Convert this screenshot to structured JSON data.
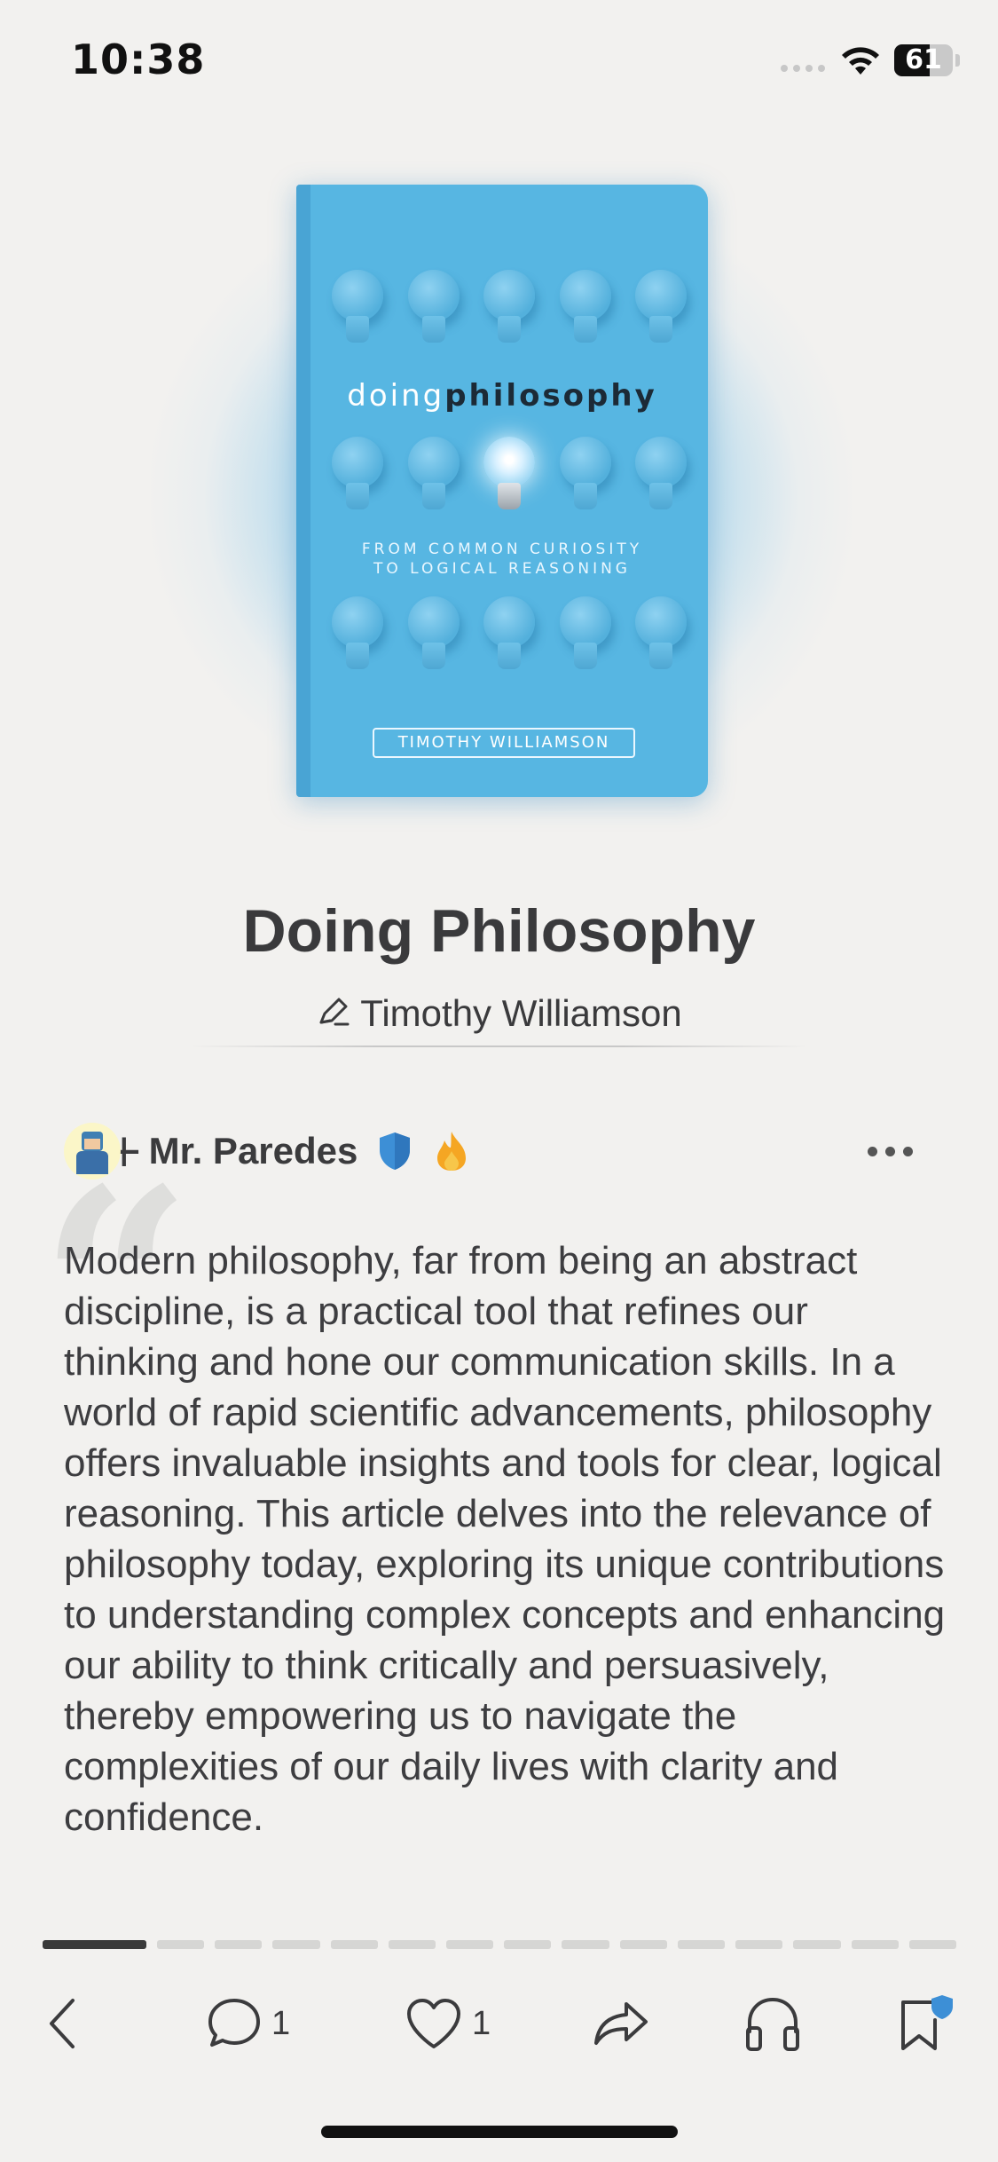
{
  "status_bar": {
    "time": "10:38",
    "battery": "61",
    "battery_level": 0.61
  },
  "cover": {
    "title_word1": "doing",
    "title_word2": "philosophy",
    "subtitle_line1": "FROM COMMON CURIOSITY",
    "subtitle_line2": "TO LOGICAL REASONING",
    "author": "TIMOTHY WILLIAMSON"
  },
  "book": {
    "title": "Doing Philosophy",
    "author": "Timothy Williamson"
  },
  "review": {
    "user_name": "Mr. Paredes",
    "text": "Modern philosophy, far from being an abstract discipline, is a practical tool that refines our thinking and hone our communication skills. In a world of rapid scientific advancements, philosophy offers invaluable insights and tools for clear, logical reasoning. This article delves into the relevance of philosophy today, exploring its unique contributions to understanding complex concepts and enhancing our ability to think critically and persuasively, thereby empowering us to navigate the complexities of our daily lives with clarity and confidence."
  },
  "pager": {
    "total": 15,
    "current": 1
  },
  "toolbar": {
    "comments_count": "1",
    "likes_count": "1"
  },
  "colors": {
    "accent_blue": "#3d8fd6",
    "cover_blue": "#57b6e2",
    "fire_orange": "#f5a623"
  },
  "icons": [
    "back-icon",
    "comment-icon",
    "heart-icon",
    "share-icon",
    "headphones-icon",
    "bookmark-icon",
    "pen-icon",
    "shield-icon",
    "fire-icon",
    "more-icon"
  ]
}
